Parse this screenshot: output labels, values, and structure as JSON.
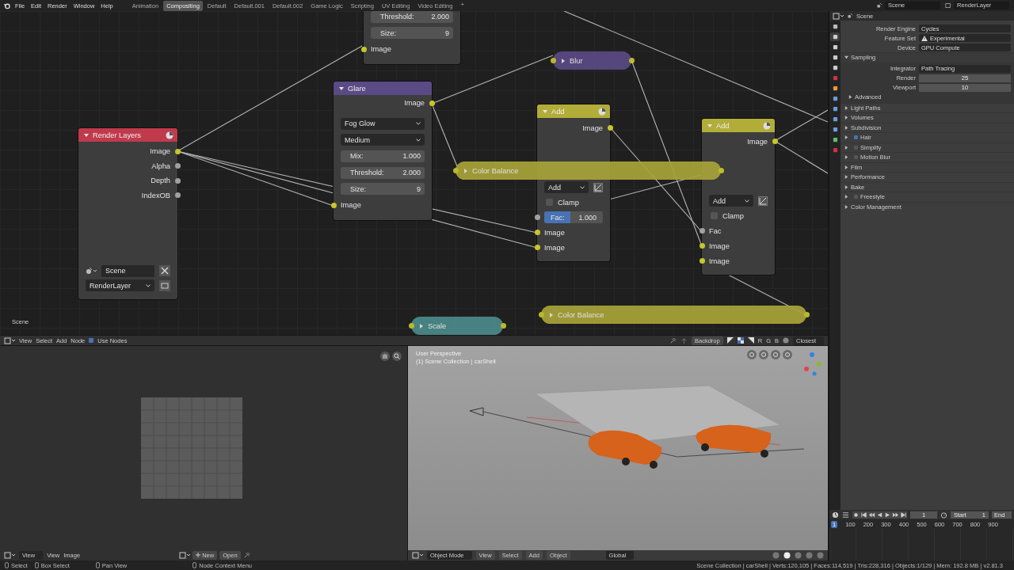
{
  "menu": [
    "File",
    "Edit",
    "Render",
    "Window",
    "Help"
  ],
  "workspaces": [
    {
      "label": "Animation",
      "selected": false
    },
    {
      "label": "Compositing",
      "selected": true
    },
    {
      "label": "Default",
      "selected": false
    },
    {
      "label": "Default.001",
      "selected": false
    },
    {
      "label": "Default.002",
      "selected": false
    },
    {
      "label": "Game Logic",
      "selected": false
    },
    {
      "label": "Scripting",
      "selected": false
    },
    {
      "label": "UV Editing",
      "selected": false
    },
    {
      "label": "Video Editing",
      "selected": false
    }
  ],
  "workspace_add": "+",
  "scene_selector": {
    "value": "Scene"
  },
  "view_layer_selector": {
    "value": "RenderLayer"
  },
  "node_editor": {
    "nodes": [
      {
        "kind": "full",
        "rows": [
          {
            "kind": "field",
            "label": "Threshold:",
            "value": "2.000"
          },
          {
            "kind": "field",
            "label": "Size:",
            "value": "9"
          },
          {
            "kind": "input",
            "label": "Image",
            "color": "#c7c729"
          }
        ]
      },
      {
        "kind": "collapsed",
        "title": "Blur",
        "color": "#5a4a86"
      },
      {
        "kind": "full",
        "title": "Glare",
        "color": "#5a4a86",
        "rows": [
          {
            "kind": "output",
            "label": "Image",
            "color": "#c7c729"
          },
          {
            "kind": "dropdown",
            "value": "Fog Glow"
          },
          {
            "kind": "dropdown",
            "value": "Medium"
          },
          {
            "kind": "field",
            "label": "Mix:",
            "value": "1.000"
          },
          {
            "kind": "field",
            "label": "Threshold:",
            "value": "2.000"
          },
          {
            "kind": "field",
            "label": "Size:",
            "value": "9"
          },
          {
            "kind": "input",
            "label": "Image",
            "color": "#c7c729"
          }
        ]
      },
      {
        "kind": "full",
        "title": "Add",
        "color": "#b2ad38",
        "preview": true,
        "rows": [
          {
            "kind": "output",
            "label": "Image",
            "color": "#c7c729"
          },
          {
            "kind": "dropdown",
            "value": "Add",
            "toggle": true
          },
          {
            "kind": "checkbox",
            "label": "Clamp",
            "checked": false
          },
          {
            "kind": "factor",
            "label": "Fac:",
            "value": "1.000",
            "color": "#a1a1a1"
          },
          {
            "kind": "input",
            "label": "Image",
            "color": "#c7c729"
          },
          {
            "kind": "input",
            "label": "Image",
            "color": "#c7c729"
          }
        ]
      },
      {
        "kind": "full",
        "title": "Add",
        "color": "#b2ad38",
        "preview": true,
        "rows": [
          {
            "kind": "output",
            "label": "Image",
            "color": "#c7c729"
          },
          {
            "kind": "dropdown",
            "value": "Add",
            "toggle": true
          },
          {
            "kind": "checkbox",
            "label": "Clamp",
            "checked": false
          },
          {
            "kind": "input",
            "label": "Fac",
            "color": "#a1a1a1"
          },
          {
            "kind": "input",
            "label": "Image",
            "color": "#c7c729"
          },
          {
            "kind": "input",
            "label": "Image",
            "color": "#c7c729"
          }
        ]
      },
      {
        "kind": "full",
        "title": "Render Layers",
        "color": "#c13a4c",
        "preview": true,
        "rows": [
          {
            "kind": "output",
            "label": "Image",
            "color": "#c7c729"
          },
          {
            "kind": "output",
            "label": "Alpha",
            "color": "#a1a1a1"
          },
          {
            "kind": "output",
            "label": "Depth",
            "color": "#a1a1a1"
          },
          {
            "kind": "output",
            "label": "IndexOB",
            "color": "#a1a1a1"
          },
          {
            "kind": "scene",
            "value": "Scene"
          },
          {
            "kind": "select",
            "value": "RenderLayer"
          }
        ]
      },
      {
        "kind": "collapsed",
        "title": "Color Balance",
        "color": "#a9a43a"
      },
      {
        "kind": "collapsed",
        "title": "Color Balance",
        "color": "#a9a43a"
      },
      {
        "kind": "collapsed",
        "title": "Scale",
        "color": "#4b8a8a"
      }
    ],
    "scene_label": "Scene",
    "header": {
      "menus": [
        "View",
        "Select",
        "Add",
        "Node"
      ],
      "use_nodes": {
        "label": "Use Nodes",
        "checked": true
      },
      "backdrop": "Backdrop",
      "channels": [
        "R",
        "G",
        "B"
      ],
      "filter": "Closest"
    }
  },
  "image_editor": {
    "header": {
      "view_dropdown": "View",
      "menus": [
        "View",
        "Image"
      ],
      "new": "New",
      "open": "Open"
    }
  },
  "viewport": {
    "overlay_lines": [
      "User Perspective",
      "(1) Scene Collection | carShell"
    ],
    "header": {
      "mode": "Object Mode",
      "menus": [
        "View",
        "Select",
        "Add",
        "Object"
      ],
      "orientation": "Global"
    }
  },
  "properties": {
    "context": "Scene",
    "tabs": [
      {
        "selected": false
      },
      {
        "selected": true
      },
      {
        "selected": false
      },
      {
        "selected": false
      },
      {
        "selected": false
      },
      {
        "selected": false
      },
      {
        "selected": false
      },
      {
        "selected": false
      },
      {
        "selected": false
      },
      {
        "selected": false
      },
      {
        "selected": false
      },
      {
        "selected": false
      },
      {
        "selected": false
      }
    ],
    "fields": [
      {
        "label": "Render Engine",
        "value": "Cycles"
      },
      {
        "label": "Feature Set",
        "value": "Experimental",
        "warning": true
      },
      {
        "label": "Device",
        "value": "GPU Compute"
      }
    ],
    "panels": [
      {
        "kind": "panel",
        "title": "Sampling",
        "expanded": true,
        "fields": [
          {
            "kind": "dropdown",
            "label": "Integrator",
            "value": "Path Tracing"
          },
          {
            "kind": "number",
            "label": "Render",
            "value": "25"
          },
          {
            "kind": "number",
            "label": "Viewport",
            "value": "10"
          }
        ],
        "subpanels": [
          {
            "title": "Advanced",
            "expanded": false
          }
        ]
      },
      {
        "kind": "panel",
        "title": "Light Paths",
        "expanded": false
      },
      {
        "kind": "panel",
        "title": "Volumes",
        "expanded": false
      },
      {
        "kind": "panel",
        "title": "Subdivision",
        "expanded": false
      },
      {
        "kind": "checkbox",
        "title": "Hair",
        "expanded": false,
        "checked": true
      },
      {
        "kind": "checkbox",
        "title": "Simplify",
        "expanded": false,
        "checked": false
      },
      {
        "kind": "checkbox",
        "title": "Motion Blur",
        "expanded": false,
        "checked": false
      },
      {
        "kind": "panel",
        "title": "Film",
        "expanded": false
      },
      {
        "kind": "panel",
        "title": "Performance",
        "expanded": false
      },
      {
        "kind": "panel",
        "title": "Bake",
        "expanded": false
      },
      {
        "kind": "checkbox",
        "title": "Freestyle",
        "expanded": false,
        "checked": false
      },
      {
        "kind": "panel",
        "title": "Color Management",
        "expanded": false
      }
    ]
  },
  "timeline": {
    "frame": "1",
    "start_label": "Start",
    "start": "1",
    "end_label": "End",
    "current_frame": "1",
    "ruler": [
      "100",
      "200",
      "300",
      "400",
      "500",
      "600",
      "700",
      "800",
      "900"
    ]
  },
  "status_bar": {
    "hints": [
      "Select",
      "Box Select",
      "Pan View",
      "Node Context Menu"
    ],
    "stats": "Scene Collection | carShell | Verts:120,105 | Faces:114,519 | Tris:228,316 | Objects:1/129 | Mem: 192.8 MB | v2.81.3"
  }
}
